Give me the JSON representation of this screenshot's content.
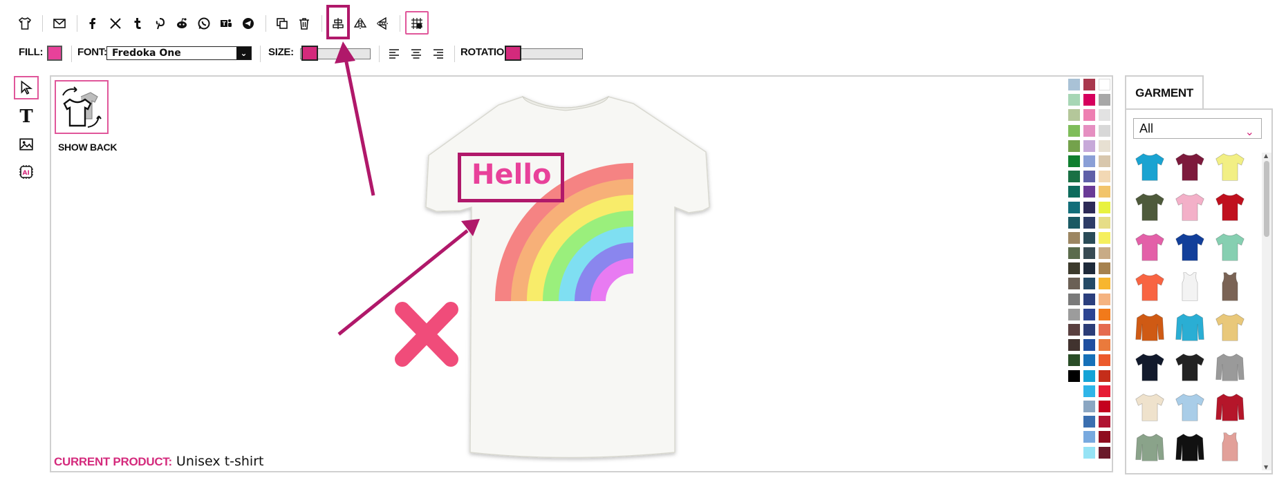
{
  "toolbar": {
    "icons": [
      "tshirt-icon",
      "email-icon",
      "facebook-icon",
      "x-icon",
      "tumblr-icon",
      "pinterest-icon",
      "reddit-icon",
      "whatsapp-icon",
      "teams-icon",
      "telegram-icon",
      "duplicate-icon",
      "trash-icon",
      "align-center-icon",
      "flip-horizontal-icon",
      "flip-vertical-icon",
      "grid-snap-icon"
    ]
  },
  "properties": {
    "fill_label": "FILL:",
    "font_label": "FONT:",
    "font_value": "Fredoka One",
    "size_label": "SIZE:",
    "rotation_label": "ROTATION:",
    "fill_color": "#e8419a"
  },
  "left_tools": [
    "select-icon",
    "text-icon",
    "image-icon",
    "ai-icon"
  ],
  "canvas": {
    "show_back_label": "SHOW BACK",
    "current_product_label": "CURRENT PRODUCT:",
    "current_product_value": "Unisex t-shirt",
    "design_text": "Hello"
  },
  "palette": {
    "col1": [
      "#a9c2d6",
      "#a7d6b5",
      "#b4c79a",
      "#7fbd5a",
      "#74a24c",
      "#0f7f2f",
      "#197044",
      "#0d6b5c",
      "#136e7a",
      "#1b5a64",
      "#9c8662",
      "#5b6b4c",
      "#3c3a2c",
      "#6b6055",
      "#7a7a7a",
      "#9c9c9c",
      "#5a4040",
      "#41332f",
      "#2a4d27",
      "#000000"
    ],
    "col2": [
      "#a9384d",
      "#d6005d",
      "#ee7fb2",
      "#e58fc1",
      "#c7a9d9",
      "#8a9fd6",
      "#5f5fa8",
      "#6a3a96",
      "#2d2a57",
      "#2e3c66",
      "#2a4b57",
      "#384a52",
      "#1e2a3a",
      "#244a66",
      "#2b3f7d",
      "#2d4592",
      "#2c3d77",
      "#1f4fa0",
      "#1670b8",
      "#14a3d6",
      "#2fb5e8",
      "#8ba6c2",
      "#3b6fb0",
      "#78a9df",
      "#96e3f5"
    ],
    "col3": [
      "#ffffff",
      "#a8a8a8",
      "#e2e2e2",
      "#d8d8d8",
      "#e7e0d2",
      "#d8c7ad",
      "#f2d8b4",
      "#f2c46b",
      "#e8f23f",
      "#e6dd87",
      "#f5ef5e",
      "#c8ab86",
      "#a6824f",
      "#f7b62e",
      "#f5b380",
      "#f27a1a",
      "#e56b4f",
      "#ea7a3c",
      "#ec5a2c",
      "#c52d1a",
      "#e61b35",
      "#c4001e",
      "#b01432",
      "#8f0c1f",
      "#6a1a2a"
    ]
  },
  "garment": {
    "tab_label": "GARMENT",
    "filter_value": "All",
    "items": [
      {
        "name": "turquoise-tee",
        "color": "#1aa3d1"
      },
      {
        "name": "maroon-tee",
        "color": "#7d1a3c"
      },
      {
        "name": "yellow-tee",
        "color": "#f2ef84"
      },
      {
        "name": "olive-tee",
        "color": "#4e5a3b"
      },
      {
        "name": "pink-tee",
        "color": "#f3b0c8"
      },
      {
        "name": "red-tee",
        "color": "#c0101e"
      },
      {
        "name": "fuchsia-tee",
        "color": "#e360a8"
      },
      {
        "name": "royal-tee",
        "color": "#123f9a"
      },
      {
        "name": "mint-tee",
        "color": "#86cfb1"
      },
      {
        "name": "coral-tee",
        "color": "#f86442"
      },
      {
        "name": "white-tank",
        "color": "#f3f3f3"
      },
      {
        "name": "brown-tank",
        "color": "#7a6355"
      },
      {
        "name": "orange-hoodie",
        "color": "#cf5a14"
      },
      {
        "name": "turquoise-hoodie",
        "color": "#2aaed4"
      },
      {
        "name": "tiedye-tee",
        "color": "#e9c87a"
      },
      {
        "name": "navy-tee",
        "color": "#121a2c"
      },
      {
        "name": "raglan-tee",
        "color": "#222222"
      },
      {
        "name": "grey-hoodie",
        "color": "#9a9a9a"
      },
      {
        "name": "beige-tee",
        "color": "#efe2cc"
      },
      {
        "name": "dipdye-tee",
        "color": "#a9cde8"
      },
      {
        "name": "varsity-jacket",
        "color": "#b5162a"
      },
      {
        "name": "sage-longsleeve",
        "color": "#8aa38a"
      },
      {
        "name": "black-orange-hoodie",
        "color": "#111111"
      },
      {
        "name": "rose-tank",
        "color": "#e2a099"
      }
    ]
  }
}
